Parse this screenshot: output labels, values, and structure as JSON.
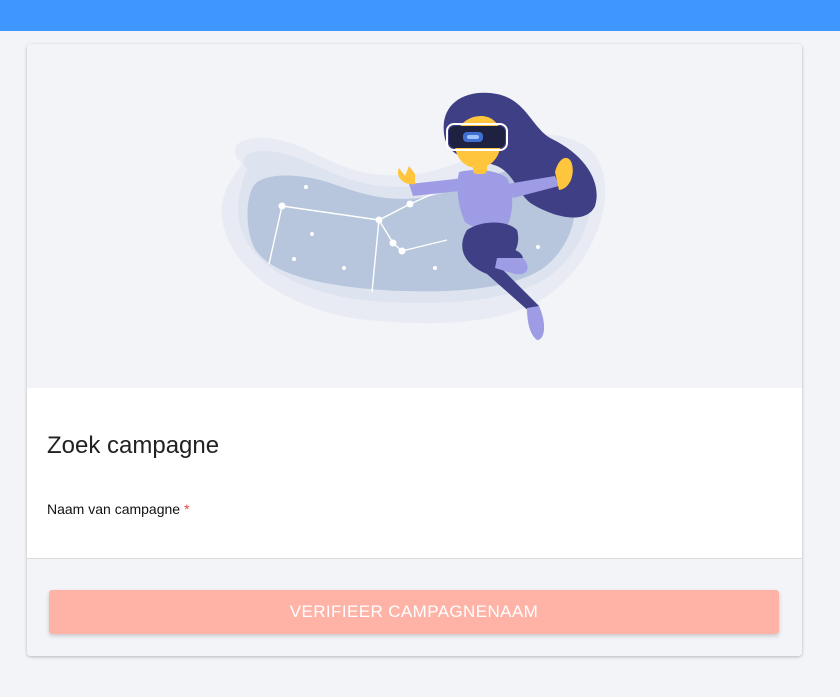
{
  "header": {
    "color": "#4096ff"
  },
  "hero": {
    "illustration": "vr-headset-woman-constellation-illustration"
  },
  "form": {
    "title": "Zoek campagne",
    "campaign_name_label": "Naam van campagne",
    "required_marker": "*",
    "campaign_name_value": "",
    "verify_button_label": "VERIFIEER CAMPAGNENAAM"
  },
  "colors": {
    "accent": "#4096ff",
    "button_disabled": "#ffb3a7",
    "required": "#ef4444"
  }
}
